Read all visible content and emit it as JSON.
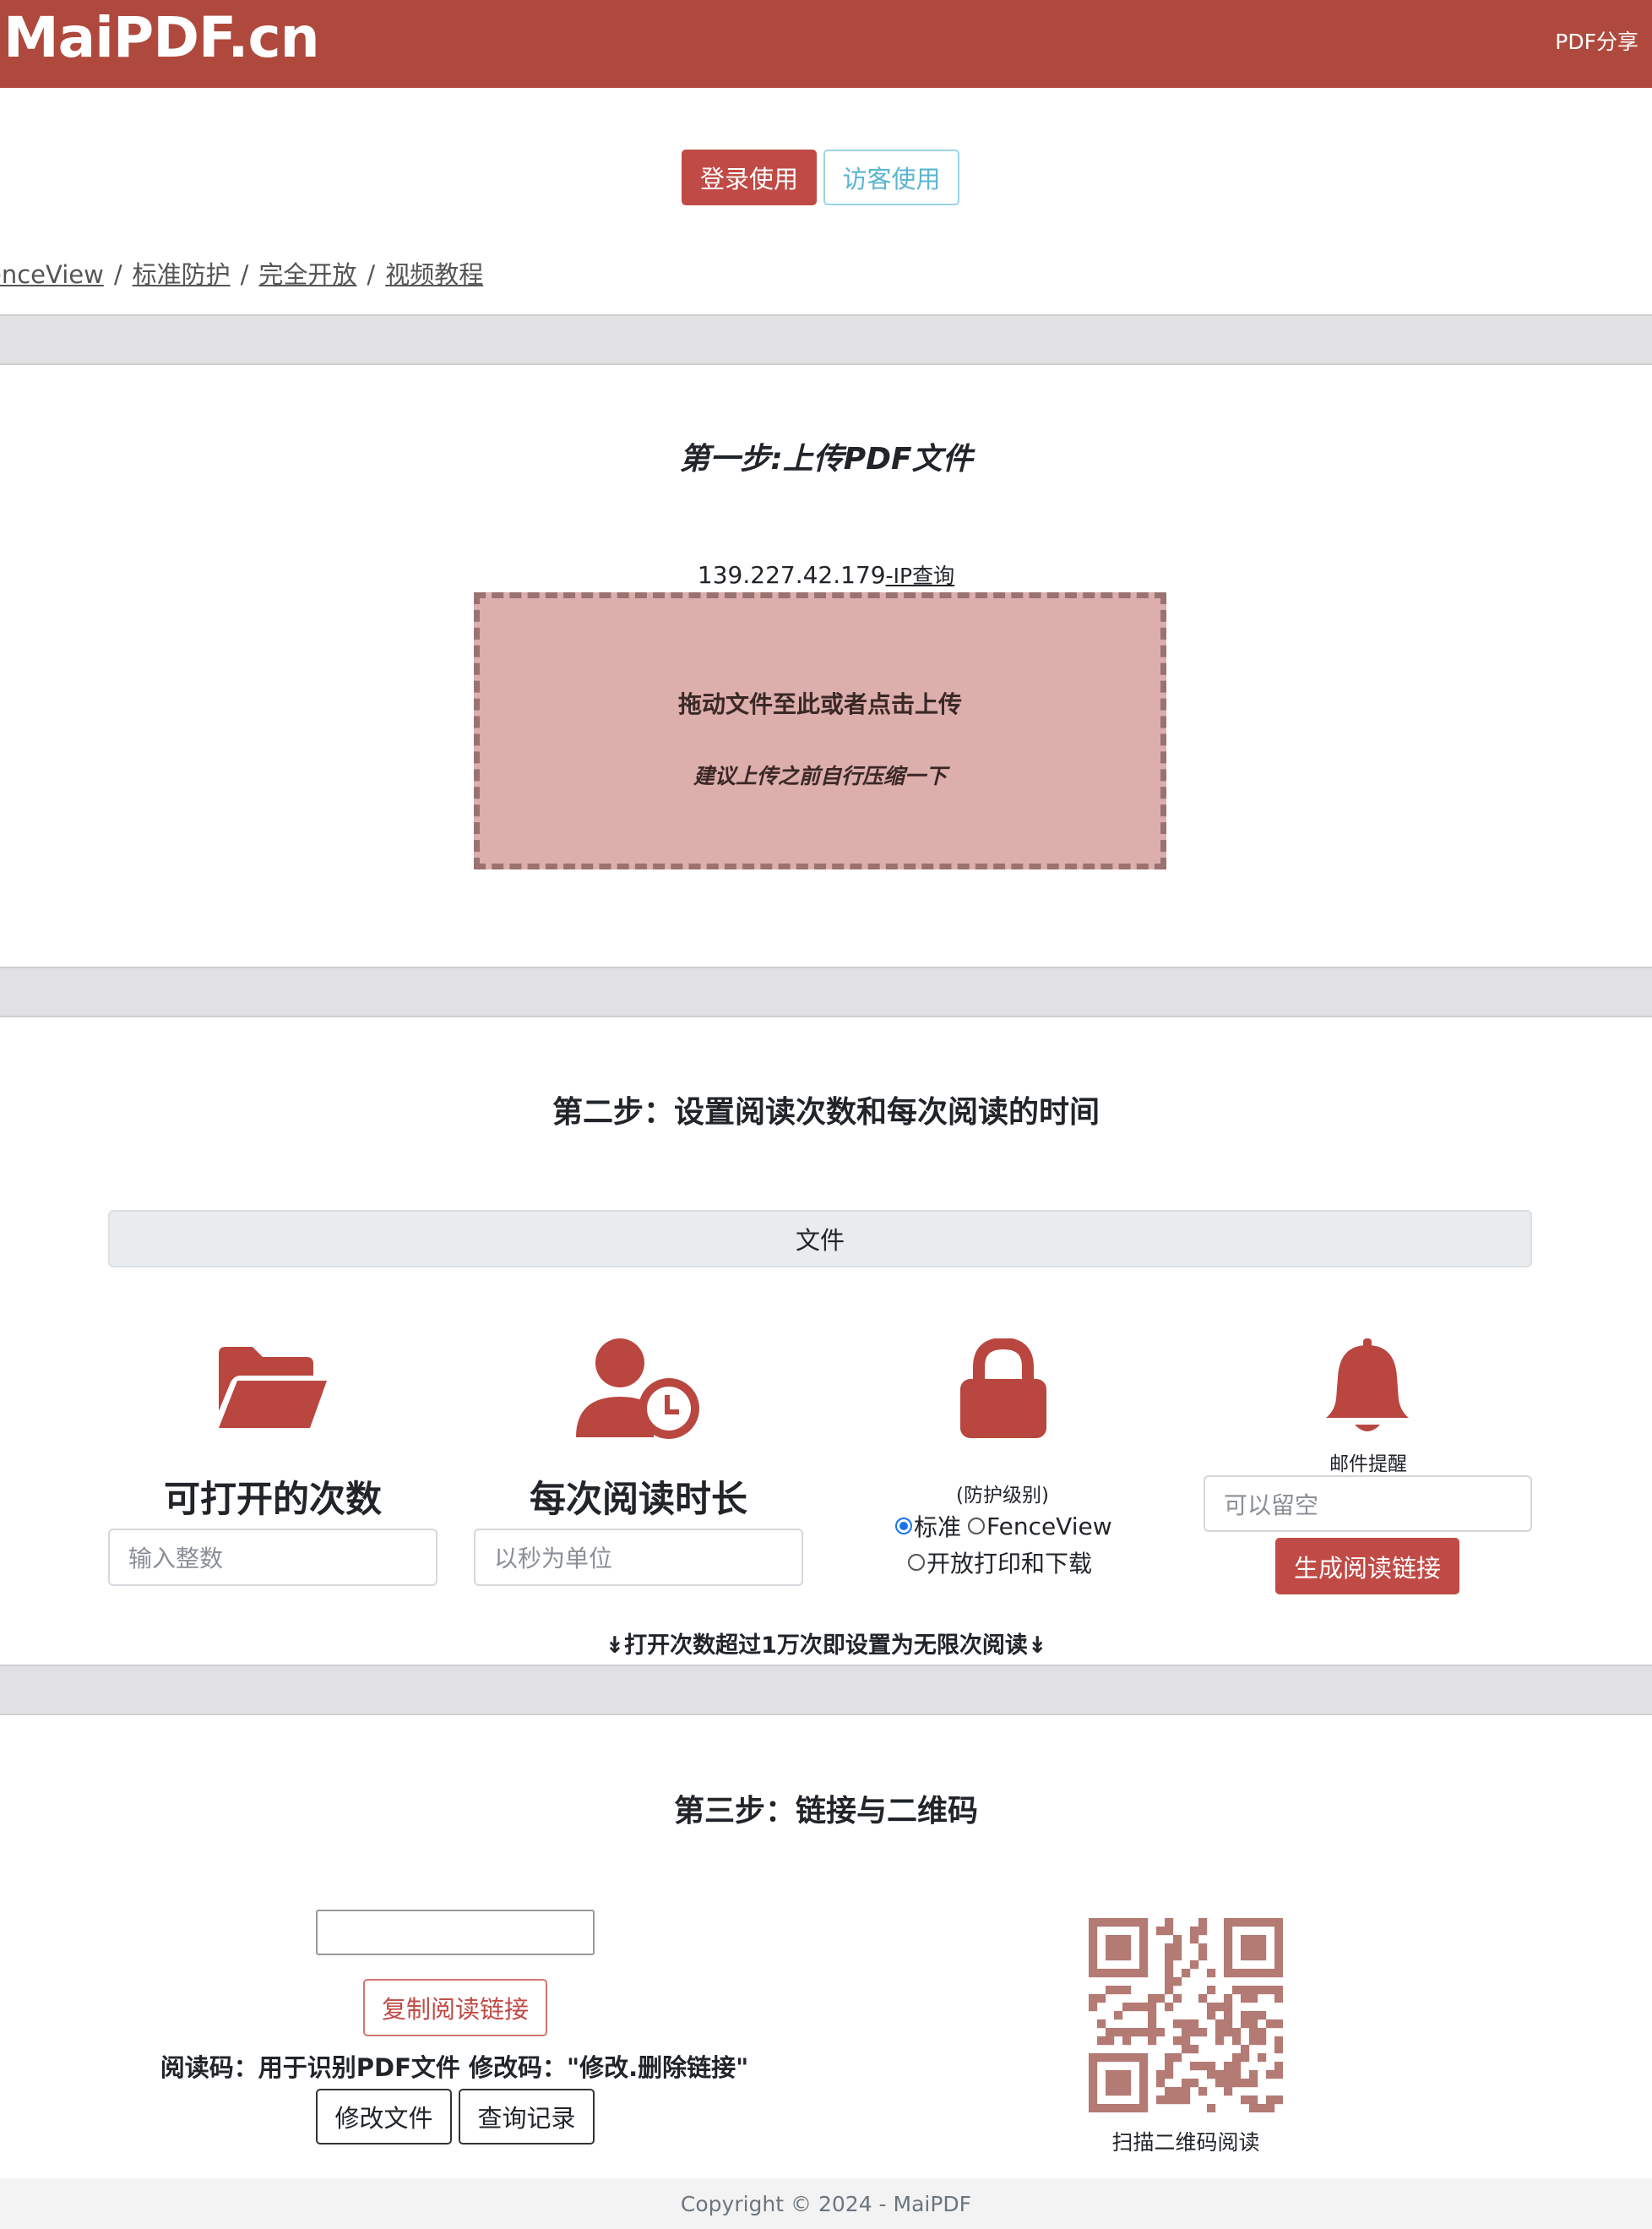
{
  "brand": "MaiPDF.cn",
  "nav": {
    "link": "PDF分享"
  },
  "auth": {
    "login": "登录使用",
    "guest": "访客使用"
  },
  "breadcrumb": {
    "items": [
      "enceView",
      "标准防护",
      "完全开放",
      "视频教程"
    ],
    "separator": "/"
  },
  "step1": {
    "title": "第一步:上传PDF文件",
    "ip": "139.227.42.179",
    "ip_link": "-IP查询",
    "drop_text": "拖动文件至此或者点击上传",
    "drop_hint": "建议上传之前自行压缩一下"
  },
  "step2": {
    "title": "第二步：设置阅读次数和每次阅读的时间",
    "file_label": "文件",
    "open_count": {
      "title": "可打开的次数",
      "placeholder": "输入整数",
      "icon": "folder-open-icon"
    },
    "read_time": {
      "title": "每次阅读时长",
      "placeholder": "以秒为单位",
      "icon": "user-clock-icon"
    },
    "protection": {
      "icon": "lock-icon",
      "label": "(防护级别)",
      "options": [
        "标准",
        "FenceView",
        "开放打印和下载"
      ],
      "selected": "标准"
    },
    "email": {
      "icon": "bell-icon",
      "label": "邮件提醒",
      "placeholder": "可以留空"
    },
    "generate": "生成阅读链接",
    "note": "↡打开次数超过1万次即设置为无限次阅读↡"
  },
  "step3": {
    "title": "第三步：链接与二维码",
    "link_value": "",
    "copy": "复制阅读链接",
    "codes_note": "阅读码：用于识别PDF文件 修改码：\"修改.删除链接\"",
    "modify": "修改文件",
    "history": "查询记录",
    "qr_caption": "扫描二维码阅读"
  },
  "footer": "Copyright © 2024 - MaiPDF",
  "colors": {
    "brand": "#b0493d",
    "accent": "#c04a45",
    "dropzone": "#dcaeac",
    "qr": "#b47a74"
  }
}
